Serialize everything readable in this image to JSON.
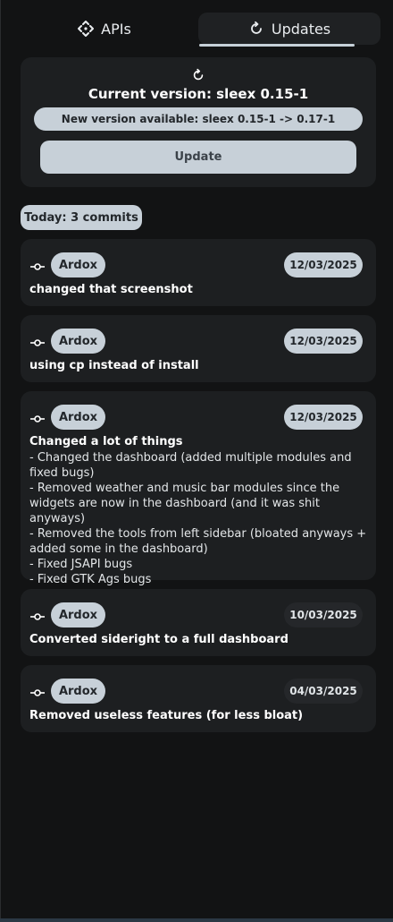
{
  "tabs": [
    {
      "label": "APIs",
      "icon": "move-arrows-icon",
      "active": false
    },
    {
      "label": "Updates",
      "icon": "refresh-icon",
      "active": true
    }
  ],
  "version": {
    "icon": "refresh-icon",
    "current": "Current version: sleex 0.15-1",
    "available": "New version available: sleex 0.15-1 -> 0.17-1",
    "update_label": "Update"
  },
  "day_group": {
    "label": "Today: 3 commits"
  },
  "commits": [
    {
      "author": "Ardox",
      "date": "12/03/2025",
      "today": true,
      "message": "changed that screenshot",
      "body": []
    },
    {
      "author": "Ardox",
      "date": "12/03/2025",
      "today": true,
      "message": "using cp instead of install",
      "body": []
    },
    {
      "author": "Ardox",
      "date": "12/03/2025",
      "today": true,
      "message": "Changed a lot of things",
      "body": [
        "- Changed the dashboard (added multiple modules and fixed bugs)",
        "- Removed weather and music bar modules since the widgets are now in the dashboard (and it was shit anyways)",
        "- Removed the tools from left sidebar (bloated anyways + added some in the dashboard)",
        "- Fixed JSAPI bugs",
        "- Fixed GTK Ags bugs"
      ]
    },
    {
      "author": "Ardox",
      "date": "10/03/2025",
      "today": false,
      "message": "Converted sideright to a full dashboard",
      "body": []
    },
    {
      "author": "Ardox",
      "date": "04/03/2025",
      "today": false,
      "message": "Removed useless features (for less bloat)",
      "body": []
    }
  ],
  "colors": {
    "background": "#121314",
    "card": "#1d1f21",
    "pill": "#c7d0d8",
    "pill_text": "#23272b"
  }
}
